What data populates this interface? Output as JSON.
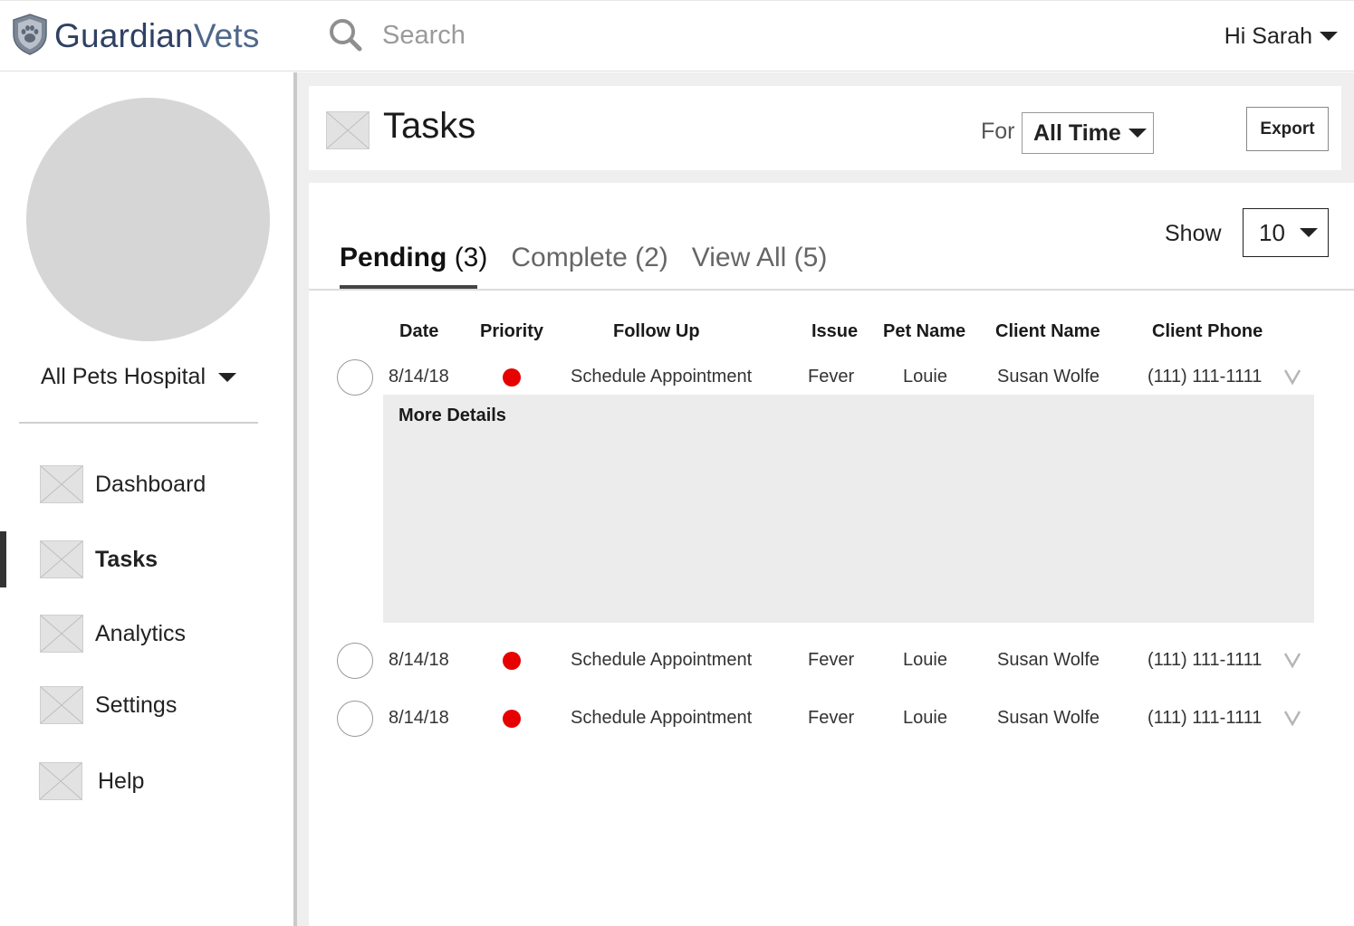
{
  "header": {
    "brand_part1": "Guardian",
    "brand_part2": "Vets",
    "search_placeholder": "Search",
    "greeting": "Hi Sarah"
  },
  "sidebar": {
    "hospital": "All Pets Hospital",
    "items": [
      {
        "label": "Dashboard",
        "icon": "image-placeholder-icon"
      },
      {
        "label": "Tasks",
        "icon": "image-placeholder-icon",
        "active": true
      },
      {
        "label": "Analytics",
        "icon": "image-placeholder-icon"
      },
      {
        "label": "Settings",
        "icon": "image-placeholder-icon"
      },
      {
        "label": "Help",
        "icon": "image-placeholder-icon"
      }
    ]
  },
  "main": {
    "title": "Tasks",
    "for_label": "For",
    "time_filter": "All Time",
    "export_label": "Export",
    "show_label": "Show",
    "show_value": "10",
    "tabs": [
      {
        "name": "Pending",
        "count": "(3)",
        "active": true
      },
      {
        "name": "Complete",
        "count": "(2)"
      },
      {
        "name": "View All",
        "count": "(5)"
      }
    ],
    "columns": [
      "Date",
      "Priority",
      "Follow Up",
      "Issue",
      "Pet Name",
      "Client Name",
      "Client Phone"
    ],
    "rows": [
      {
        "date": "8/14/18",
        "priority": "high",
        "follow_up": "Schedule Appointment",
        "issue": "Fever",
        "pet": "Louie",
        "client": "Susan Wolfe",
        "phone": "(111) 111-1111",
        "expanded": true
      },
      {
        "date": "8/14/18",
        "priority": "high",
        "follow_up": "Schedule Appointment",
        "issue": "Fever",
        "pet": "Louie",
        "client": "Susan Wolfe",
        "phone": "(111) 111-1111"
      },
      {
        "date": "8/14/18",
        "priority": "high",
        "follow_up": "Schedule Appointment",
        "issue": "Fever",
        "pet": "Louie",
        "client": "Susan Wolfe",
        "phone": "(111) 111-1111"
      }
    ],
    "details_title": "More Details"
  },
  "colors": {
    "brand_dark": "#2f4163",
    "brand_light": "#4f6889",
    "priority_high": "#e60000",
    "placeholder": "#e2e2e2"
  }
}
